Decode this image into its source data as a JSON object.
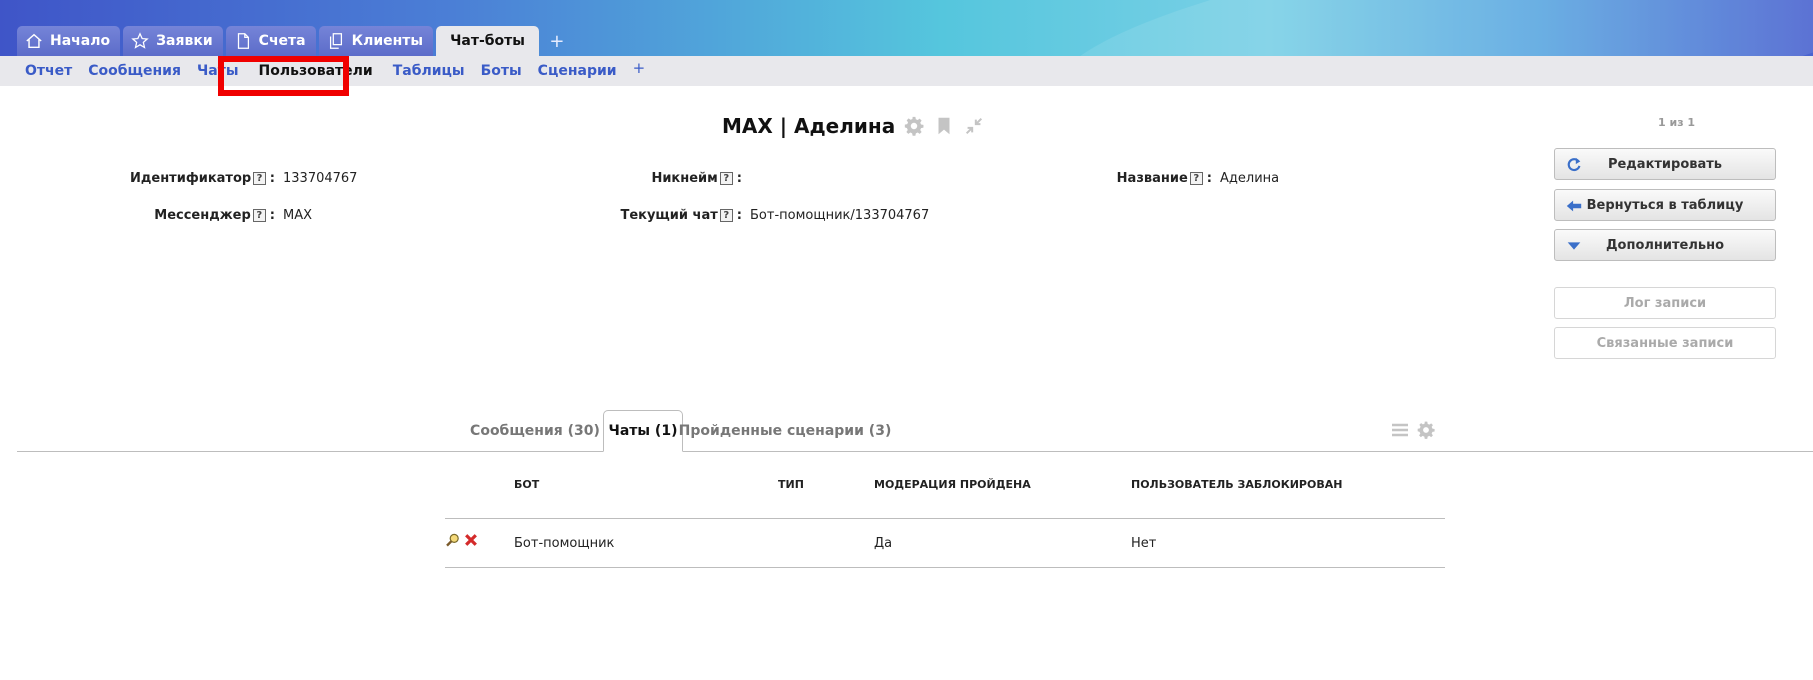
{
  "main_tabs": [
    {
      "label": "Начало",
      "icon": "home-icon"
    },
    {
      "label": "Заявки",
      "icon": "star-icon"
    },
    {
      "label": "Счета",
      "icon": "document-icon"
    },
    {
      "label": "Клиенты",
      "icon": "copy-icon"
    },
    {
      "label": "Чат-боты",
      "icon": ""
    }
  ],
  "main_tabs_add": "+",
  "sub_tabs": [
    "Отчет",
    "Сообщения",
    "Чаты",
    "Пользователи",
    "Таблицы",
    "Боты",
    "Сценарии"
  ],
  "sub_tabs_add": "+",
  "record": {
    "title": "MAX | Аделина",
    "pager": "1 из 1"
  },
  "fields": {
    "identifier": {
      "label": "Идентификатор",
      "value": "133704767"
    },
    "messenger": {
      "label": "Мессенджер",
      "value": "MAX"
    },
    "nickname": {
      "label": "Никнейм",
      "value": ""
    },
    "current_chat": {
      "label": "Текущий чат",
      "value": "Бот-помощник/133704767"
    },
    "name": {
      "label": "Название",
      "value": "Аделина"
    },
    "help_mark": "?",
    "colon": ":"
  },
  "actions": {
    "edit": "Редактировать",
    "back": "Вернуться в таблицу",
    "more": "Дополнительно",
    "log": "Лог записи",
    "related": "Связанные записи"
  },
  "detail_tabs": [
    "Сообщения (30)",
    "Чаты (1)",
    "Пройденные сценарии (3)"
  ],
  "table": {
    "columns": [
      "БОТ",
      "ТИП",
      "МОДЕРАЦИЯ ПРОЙДЕНА",
      "ПОЛЬЗОВАТЕЛЬ ЗАБЛОКИРОВАН"
    ],
    "rows": [
      {
        "bot": "Бот-помощник",
        "type": "",
        "moderation": "Да",
        "blocked": "Нет"
      }
    ]
  },
  "colors": {
    "accent_blue": "#3a5bc7",
    "highlight_red": "#f00000"
  }
}
